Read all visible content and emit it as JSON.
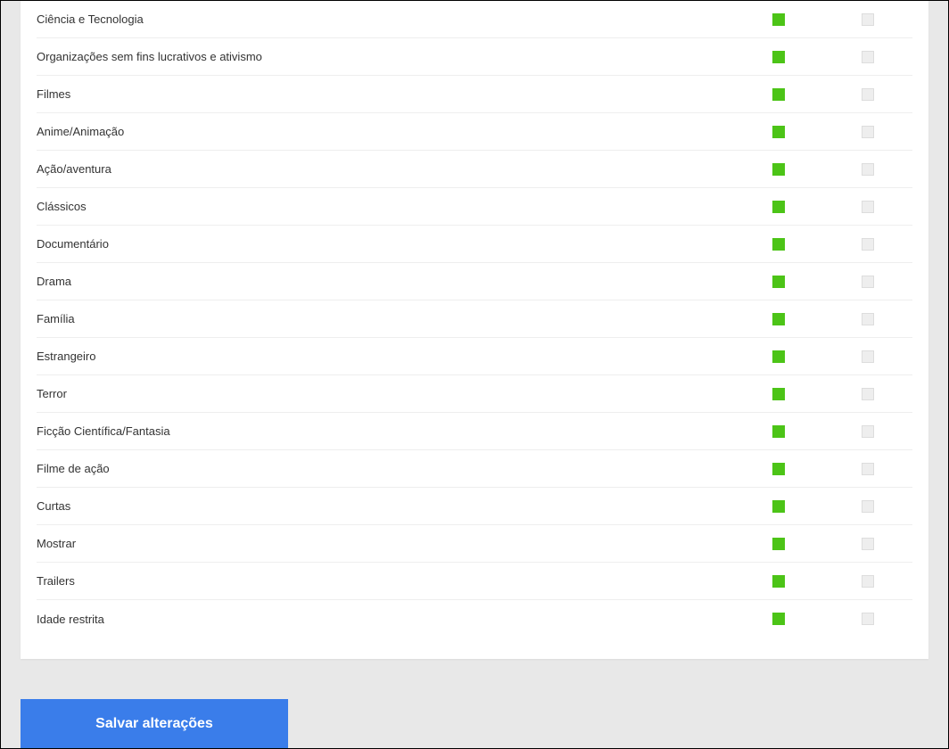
{
  "categories": {
    "items": [
      {
        "label": "Ciência e Tecnologia",
        "col1": true,
        "col2": false
      },
      {
        "label": "Organizações sem fins lucrativos e ativismo",
        "col1": true,
        "col2": false
      },
      {
        "label": "Filmes",
        "col1": true,
        "col2": false
      },
      {
        "label": "Anime/Animação",
        "col1": true,
        "col2": false
      },
      {
        "label": "Ação/aventura",
        "col1": true,
        "col2": false
      },
      {
        "label": "Clássicos",
        "col1": true,
        "col2": false
      },
      {
        "label": "Documentário",
        "col1": true,
        "col2": false
      },
      {
        "label": "Drama",
        "col1": true,
        "col2": false
      },
      {
        "label": "Família",
        "col1": true,
        "col2": false
      },
      {
        "label": "Estrangeiro",
        "col1": true,
        "col2": false
      },
      {
        "label": "Terror",
        "col1": true,
        "col2": false
      },
      {
        "label": "Ficção Científica/Fantasia",
        "col1": true,
        "col2": false
      },
      {
        "label": "Filme de ação",
        "col1": true,
        "col2": false
      },
      {
        "label": "Curtas",
        "col1": true,
        "col2": false
      },
      {
        "label": "Mostrar",
        "col1": true,
        "col2": false
      },
      {
        "label": "Trailers",
        "col1": true,
        "col2": false
      },
      {
        "label": "Idade restrita",
        "col1": true,
        "col2": false
      }
    ]
  },
  "actions": {
    "save_label": "Salvar alterações"
  },
  "colors": {
    "checked": "#4cc417",
    "unchecked": "#eeeeee",
    "primary_button": "#3a7dea"
  }
}
